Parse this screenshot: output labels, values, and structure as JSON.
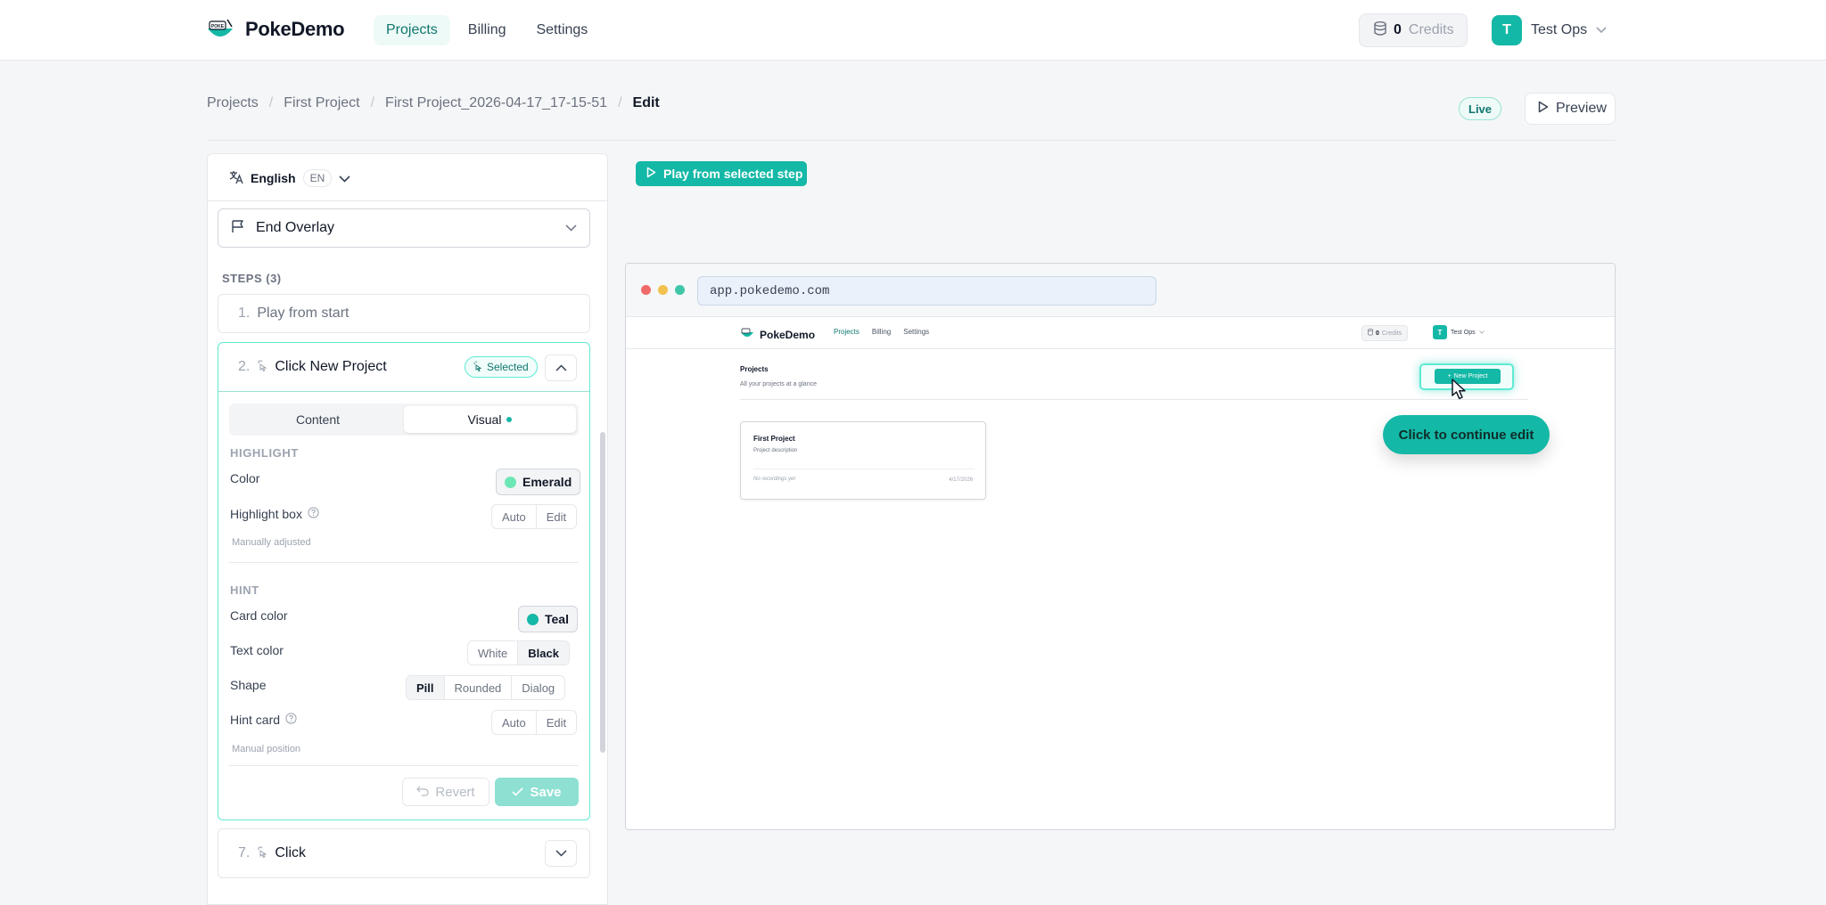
{
  "brand": {
    "name": "PokeDemo",
    "logo_text": "POKE DEMO"
  },
  "nav": {
    "items": [
      {
        "label": "Projects",
        "active": true
      },
      {
        "label": "Billing",
        "active": false
      },
      {
        "label": "Settings",
        "active": false
      }
    ]
  },
  "credits": {
    "count": "0",
    "label": "Credits"
  },
  "user": {
    "initial": "T",
    "name": "Test Ops"
  },
  "breadcrumb": {
    "items": [
      "Projects",
      "First Project",
      "First Project_2026-04-17_17-15-51",
      "Edit"
    ]
  },
  "status": {
    "live": "Live",
    "preview": "Preview"
  },
  "language": {
    "name": "English",
    "code": "EN"
  },
  "overlay": {
    "selected": "End Overlay"
  },
  "steps": {
    "label": "STEPS (3)",
    "step1": {
      "num": "1.",
      "label": "Play from start"
    },
    "step2": {
      "num": "2.",
      "label": "Click New Project",
      "badge": "Selected"
    },
    "step7": {
      "num": "7.",
      "label": "Click"
    }
  },
  "tabs": {
    "content": "Content",
    "visual": "Visual"
  },
  "highlight": {
    "section": "HIGHLIGHT",
    "color_label": "Color",
    "color_value": "Emerald",
    "box_label": "Highlight box",
    "auto": "Auto",
    "edit": "Edit",
    "note": "Manually adjusted"
  },
  "hint": {
    "section": "HINT",
    "card_color_label": "Card color",
    "card_color_value": "Teal",
    "text_color_label": "Text color",
    "text_white": "White",
    "text_black": "Black",
    "shape_label": "Shape",
    "shape_pill": "Pill",
    "shape_rounded": "Rounded",
    "shape_dialog": "Dialog",
    "hint_card_label": "Hint card",
    "auto": "Auto",
    "edit": "Edit",
    "note": "Manual position"
  },
  "actions": {
    "revert": "Revert",
    "save": "Save"
  },
  "play_button": "Play from selected step",
  "browser": {
    "url": "app.pokedemo.com"
  },
  "preview_page": {
    "brand": "PokeDemo",
    "nav": [
      "Projects",
      "Billing",
      "Settings"
    ],
    "credits_count": "0",
    "credits_label": "Credits",
    "user_initial": "T",
    "user_name": "Test Ops",
    "title": "Projects",
    "subtitle": "All your projects at a glance",
    "new_project": "New Project",
    "card_title": "First Project",
    "card_desc": "Project description",
    "card_empty": "No recordings yet",
    "card_date": "4/17/2026",
    "hint_text": "Click to continue edit"
  },
  "colors": {
    "accent": "#14b8a6",
    "emerald": "#34d399",
    "teal": "#14b8a6"
  }
}
